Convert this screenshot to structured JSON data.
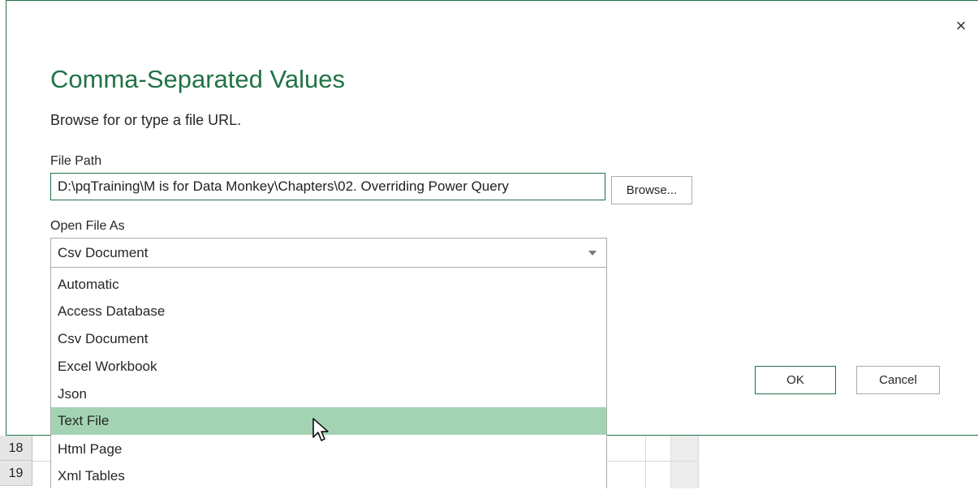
{
  "dialog": {
    "title": "Comma-Separated Values",
    "subtitle": "Browse for or type a file URL.",
    "close_glyph": "×",
    "file_path_label": "File Path",
    "file_path_value": "D:\\pqTraining\\M is for Data Monkey\\Chapters\\02. Overriding Power Query",
    "browse_label": "Browse...",
    "open_file_as_label": "Open File As",
    "selected_type": "Csv Document",
    "options": [
      {
        "label": "Automatic"
      },
      {
        "label": "Access Database"
      },
      {
        "label": "Csv Document"
      },
      {
        "label": "Excel Workbook"
      },
      {
        "label": "Json"
      },
      {
        "label": "Text File",
        "highlighted": true
      },
      {
        "label": "Html Page"
      },
      {
        "label": "Xml Tables"
      }
    ],
    "ok_label": "OK",
    "cancel_label": "Cancel"
  },
  "excel": {
    "row_numbers": [
      "18",
      "19"
    ]
  },
  "colors": {
    "accent": "#217346",
    "highlight": "#a3d3b3"
  },
  "icons": {
    "close": "close-icon",
    "dropdown_arrow": "chevron-down-icon",
    "cursor": "mouse-pointer-icon"
  }
}
